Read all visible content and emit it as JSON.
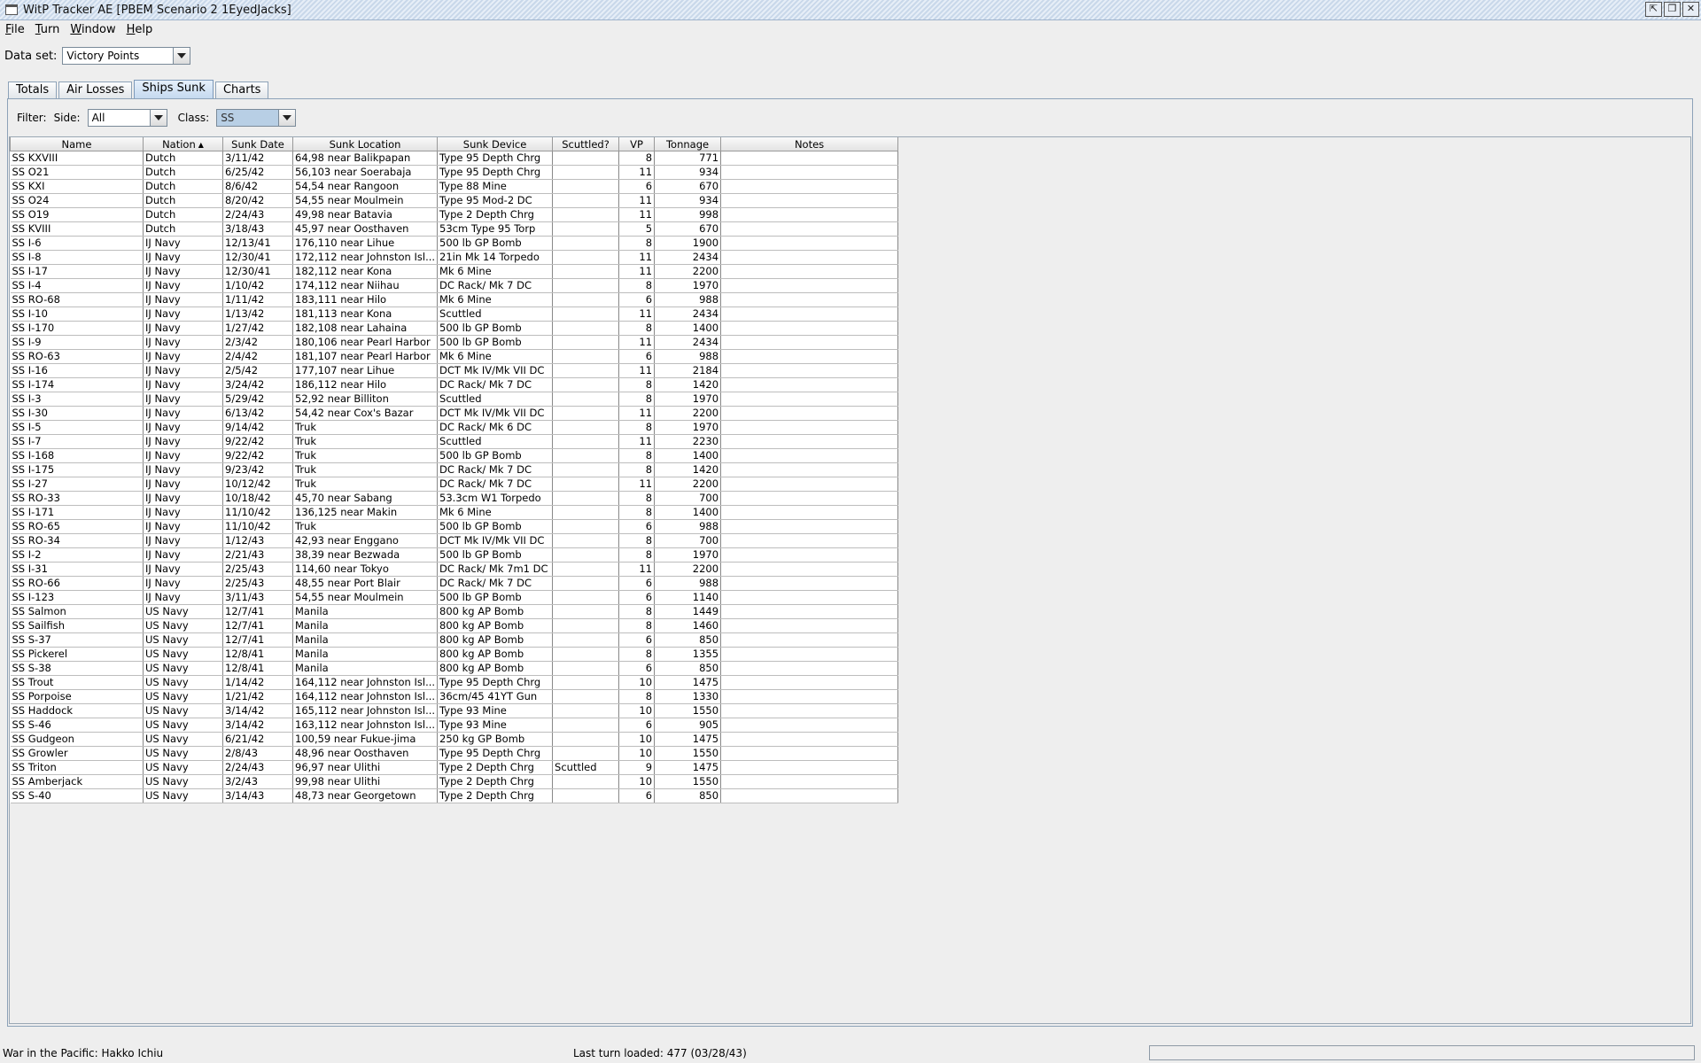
{
  "window": {
    "title": "WitP Tracker AE [PBEM Scenario 2 1EyedJacks]",
    "buttons": [
      "⇱",
      "❐",
      "✕"
    ]
  },
  "menu": [
    {
      "mnemonic": "F",
      "rest": "ile"
    },
    {
      "mnemonic": "T",
      "rest": "urn"
    },
    {
      "mnemonic": "W",
      "rest": "indow"
    },
    {
      "mnemonic": "H",
      "rest": "elp"
    }
  ],
  "dataset": {
    "label": "Data set:",
    "value": "Victory Points"
  },
  "tabs": [
    {
      "label": "Totals",
      "selected": false
    },
    {
      "label": "Air Losses",
      "selected": false
    },
    {
      "label": "Ships Sunk",
      "selected": true
    },
    {
      "label": "Charts",
      "selected": false
    }
  ],
  "filter": {
    "label": "Filter:",
    "side_label": "Side:",
    "side_value": "All",
    "class_label": "Class:",
    "class_value": "SS"
  },
  "table": {
    "columns": [
      "Name",
      "Nation",
      "Sunk Date",
      "Sunk Location",
      "Sunk Device",
      "Scuttled?",
      "VP",
      "Tonnage",
      "Notes"
    ],
    "sorted_column": "Nation",
    "rows": [
      [
        "SS KXVIII",
        "Dutch",
        "3/11/42",
        "64,98 near Balikpapan",
        "Type 95 Depth Chrg",
        "",
        "8",
        "771",
        ""
      ],
      [
        "SS O21",
        "Dutch",
        "6/25/42",
        "56,103 near Soerabaja",
        "Type 95 Depth Chrg",
        "",
        "11",
        "934",
        ""
      ],
      [
        "SS KXI",
        "Dutch",
        "8/6/42",
        "54,54 near Rangoon",
        "Type 88 Mine",
        "",
        "6",
        "670",
        ""
      ],
      [
        "SS O24",
        "Dutch",
        "8/20/42",
        "54,55 near Moulmein",
        "Type 95 Mod-2 DC",
        "",
        "11",
        "934",
        ""
      ],
      [
        "SS O19",
        "Dutch",
        "2/24/43",
        "49,98 near Batavia",
        "Type 2 Depth Chrg",
        "",
        "11",
        "998",
        ""
      ],
      [
        "SS KVIII",
        "Dutch",
        "3/18/43",
        "45,97 near Oosthaven",
        "53cm Type 95 Torp",
        "",
        "5",
        "670",
        ""
      ],
      [
        "SS I-6",
        "IJ Navy",
        "12/13/41",
        "176,110 near Lihue",
        "500 lb GP Bomb",
        "",
        "8",
        "1900",
        ""
      ],
      [
        "SS I-8",
        "IJ Navy",
        "12/30/41",
        "172,112 near Johnston Isl...",
        "21in Mk 14 Torpedo",
        "",
        "11",
        "2434",
        ""
      ],
      [
        "SS I-17",
        "IJ Navy",
        "12/30/41",
        "182,112 near Kona",
        "Mk 6 Mine",
        "",
        "11",
        "2200",
        ""
      ],
      [
        "SS I-4",
        "IJ Navy",
        "1/10/42",
        "174,112 near Niihau",
        "DC Rack/ Mk 7 DC",
        "",
        "8",
        "1970",
        ""
      ],
      [
        "SS RO-68",
        "IJ Navy",
        "1/11/42",
        "183,111 near Hilo",
        "Mk 6 Mine",
        "",
        "6",
        "988",
        ""
      ],
      [
        "SS I-10",
        "IJ Navy",
        "1/13/42",
        "181,113 near Kona",
        "Scuttled",
        "",
        "11",
        "2434",
        ""
      ],
      [
        "SS I-170",
        "IJ Navy",
        "1/27/42",
        "182,108 near Lahaina",
        "500 lb GP Bomb",
        "",
        "8",
        "1400",
        ""
      ],
      [
        "SS I-9",
        "IJ Navy",
        "2/3/42",
        "180,106 near Pearl Harbor",
        "500 lb GP Bomb",
        "",
        "11",
        "2434",
        ""
      ],
      [
        "SS RO-63",
        "IJ Navy",
        "2/4/42",
        "181,107 near Pearl Harbor",
        "Mk 6 Mine",
        "",
        "6",
        "988",
        ""
      ],
      [
        "SS I-16",
        "IJ Navy",
        "2/5/42",
        "177,107 near Lihue",
        "DCT Mk IV/Mk VII DC",
        "",
        "11",
        "2184",
        ""
      ],
      [
        "SS I-174",
        "IJ Navy",
        "3/24/42",
        "186,112 near Hilo",
        "DC Rack/ Mk 7 DC",
        "",
        "8",
        "1420",
        ""
      ],
      [
        "SS I-3",
        "IJ Navy",
        "5/29/42",
        "52,92 near Billiton",
        "Scuttled",
        "",
        "8",
        "1970",
        ""
      ],
      [
        "SS I-30",
        "IJ Navy",
        "6/13/42",
        "54,42 near Cox's Bazar",
        "DCT Mk IV/Mk VII DC",
        "",
        "11",
        "2200",
        ""
      ],
      [
        "SS I-5",
        "IJ Navy",
        "9/14/42",
        "Truk",
        "DC Rack/ Mk 6 DC",
        "",
        "8",
        "1970",
        ""
      ],
      [
        "SS I-7",
        "IJ Navy",
        "9/22/42",
        "Truk",
        "Scuttled",
        "",
        "11",
        "2230",
        ""
      ],
      [
        "SS I-168",
        "IJ Navy",
        "9/22/42",
        "Truk",
        "500 lb GP Bomb",
        "",
        "8",
        "1400",
        ""
      ],
      [
        "SS I-175",
        "IJ Navy",
        "9/23/42",
        "Truk",
        "DC Rack/ Mk 7 DC",
        "",
        "8",
        "1420",
        ""
      ],
      [
        "SS I-27",
        "IJ Navy",
        "10/12/42",
        "Truk",
        "DC Rack/ Mk 7 DC",
        "",
        "11",
        "2200",
        ""
      ],
      [
        "SS RO-33",
        "IJ Navy",
        "10/18/42",
        "45,70 near Sabang",
        "53.3cm W1 Torpedo",
        "",
        "8",
        "700",
        ""
      ],
      [
        "SS I-171",
        "IJ Navy",
        "11/10/42",
        "136,125 near Makin",
        "Mk 6 Mine",
        "",
        "8",
        "1400",
        ""
      ],
      [
        "SS RO-65",
        "IJ Navy",
        "11/10/42",
        "Truk",
        "500 lb GP Bomb",
        "",
        "6",
        "988",
        ""
      ],
      [
        "SS RO-34",
        "IJ Navy",
        "1/12/43",
        "42,93 near Enggano",
        "DCT Mk IV/Mk VII DC",
        "",
        "8",
        "700",
        ""
      ],
      [
        "SS I-2",
        "IJ Navy",
        "2/21/43",
        "38,39 near Bezwada",
        "500 lb GP Bomb",
        "",
        "8",
        "1970",
        ""
      ],
      [
        "SS I-31",
        "IJ Navy",
        "2/25/43",
        "114,60 near Tokyo",
        "DC Rack/ Mk 7m1 DC",
        "",
        "11",
        "2200",
        ""
      ],
      [
        "SS RO-66",
        "IJ Navy",
        "2/25/43",
        "48,55 near Port Blair",
        "DC Rack/ Mk 7 DC",
        "",
        "6",
        "988",
        ""
      ],
      [
        "SS I-123",
        "IJ Navy",
        "3/11/43",
        "54,55 near Moulmein",
        "500 lb GP Bomb",
        "",
        "6",
        "1140",
        ""
      ],
      [
        "SS Salmon",
        "US Navy",
        "12/7/41",
        "Manila",
        "800 kg AP Bomb",
        "",
        "8",
        "1449",
        ""
      ],
      [
        "SS Sailfish",
        "US Navy",
        "12/7/41",
        "Manila",
        "800 kg AP Bomb",
        "",
        "8",
        "1460",
        ""
      ],
      [
        "SS S-37",
        "US Navy",
        "12/7/41",
        "Manila",
        "800 kg AP Bomb",
        "",
        "6",
        "850",
        ""
      ],
      [
        "SS Pickerel",
        "US Navy",
        "12/8/41",
        "Manila",
        "800 kg AP Bomb",
        "",
        "8",
        "1355",
        ""
      ],
      [
        "SS S-38",
        "US Navy",
        "12/8/41",
        "Manila",
        "800 kg AP Bomb",
        "",
        "6",
        "850",
        ""
      ],
      [
        "SS Trout",
        "US Navy",
        "1/14/42",
        "164,112 near Johnston Isl...",
        "Type 95 Depth Chrg",
        "",
        "10",
        "1475",
        ""
      ],
      [
        "SS Porpoise",
        "US Navy",
        "1/21/42",
        "164,112 near Johnston Isl...",
        "36cm/45 41YT Gun",
        "",
        "8",
        "1330",
        ""
      ],
      [
        "SS Haddock",
        "US Navy",
        "3/14/42",
        "165,112 near Johnston Isl...",
        "Type 93 Mine",
        "",
        "10",
        "1550",
        ""
      ],
      [
        "SS S-46",
        "US Navy",
        "3/14/42",
        "163,112 near Johnston Isl...",
        "Type 93 Mine",
        "",
        "6",
        "905",
        ""
      ],
      [
        "SS Gudgeon",
        "US Navy",
        "6/21/42",
        "100,59 near Fukue-jima",
        "250 kg GP Bomb",
        "",
        "10",
        "1475",
        ""
      ],
      [
        "SS Growler",
        "US Navy",
        "2/8/43",
        "48,96 near Oosthaven",
        "Type 95 Depth Chrg",
        "",
        "10",
        "1550",
        ""
      ],
      [
        "SS Triton",
        "US Navy",
        "2/24/43",
        "96,97 near Ulithi",
        "Type 2 Depth Chrg",
        "Scuttled",
        "9",
        "1475",
        ""
      ],
      [
        "SS Amberjack",
        "US Navy",
        "3/2/43",
        "99,98 near Ulithi",
        "Type 2 Depth Chrg",
        "",
        "10",
        "1550",
        ""
      ],
      [
        "SS S-40",
        "US Navy",
        "3/14/43",
        "48,73 near Georgetown",
        "Type 2 Depth Chrg",
        "",
        "6",
        "850",
        ""
      ]
    ]
  },
  "status": {
    "left": "War in the Pacific: Hakko Ichiu",
    "middle": "Last turn loaded: 477 (03/28/43)"
  },
  "colors": {
    "background": "#eeeeee",
    "selected_tab": "#c5d9ef",
    "class_combo_highlight": "#b8cfe5"
  }
}
